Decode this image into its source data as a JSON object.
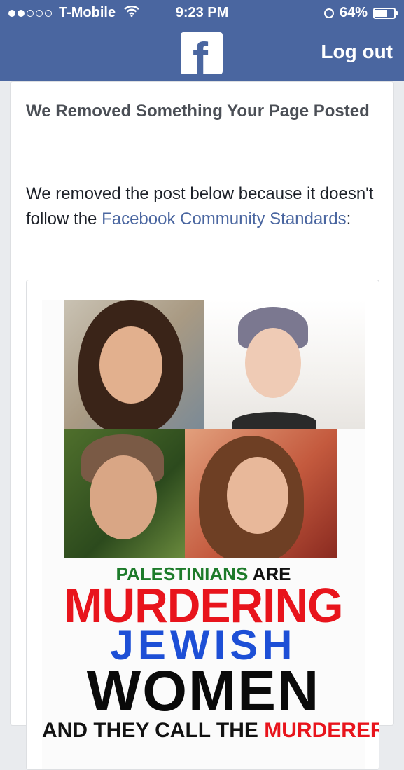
{
  "status_bar": {
    "carrier": "T-Mobile",
    "time": "9:23 PM",
    "battery": "64%",
    "battery_level": 0.64
  },
  "nav": {
    "logo_letter": "f",
    "logout_label": "Log out"
  },
  "card": {
    "title": "We Removed Something Your Page Posted",
    "body_prefix": "We removed the post below because it doesn't follow the ",
    "link": "Facebook Community Standards",
    "body_suffix": ":"
  },
  "post_image": {
    "line1_green": "PALESTINIANS",
    "line1_black": "ARE",
    "line2": "MURDERING",
    "line3": "JEWISH",
    "line4": "WOMEN",
    "line5_black": "AND THEY CALL THE",
    "line5_red": "MURDERERS"
  }
}
